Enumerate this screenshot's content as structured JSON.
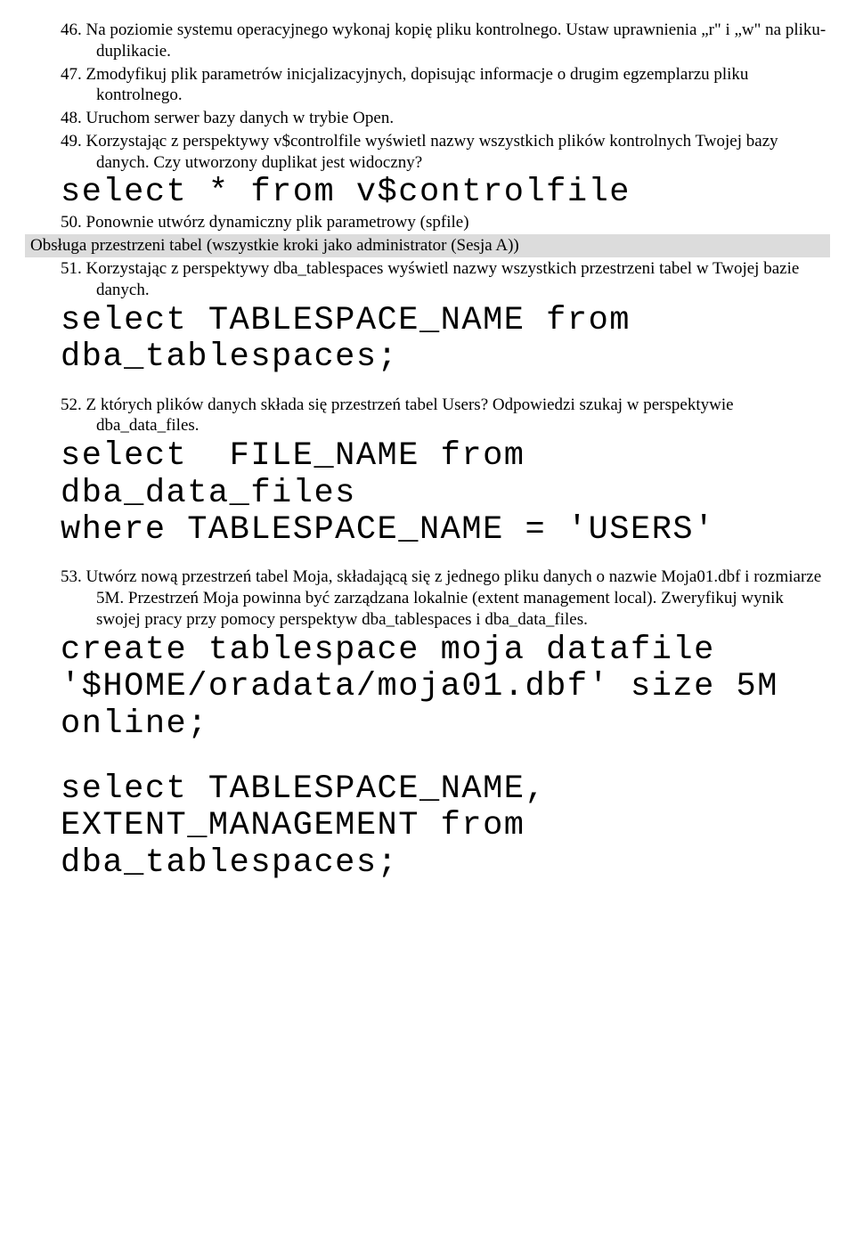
{
  "items": {
    "i46": {
      "num": "46.",
      "text": "Na poziomie systemu operacyjnego wykonaj kopię pliku kontrolnego. Ustaw uprawnienia „r\" i „w\" na pliku-duplikacie."
    },
    "i47": {
      "num": "47.",
      "text": "Zmodyfikuj plik parametrów inicjalizacyjnych, dopisując informacje o drugim egzemplarzu pliku kontrolnego."
    },
    "i48": {
      "num": "48.",
      "text": "Uruchom serwer bazy danych w trybie Open."
    },
    "i49": {
      "num": "49.",
      "text": "Korzystając z perspektywy v$controlfile wyświetl nazwy wszystkich plików kontrolnych Twojej bazy danych. Czy utworzony duplikat jest widoczny?"
    },
    "i50": {
      "num": "50.",
      "text": "Ponownie utwórz dynamiczny plik parametrowy (spfile)"
    },
    "i51": {
      "num": "51.",
      "text": "Korzystając z perspektywy dba_tablespaces wyświetl nazwy wszystkich przestrzeni tabel w Twojej bazie danych."
    },
    "i52": {
      "num": "52.",
      "text": "Z których plików danych składa się przestrzeń tabel Users? Odpowiedzi szukaj w perspektywie dba_data_files."
    },
    "i53": {
      "num": "53.",
      "text": "Utwórz nową przestrzeń tabel Moja, składającą się z jednego pliku danych o nazwie Moja01.dbf i rozmiarze 5M. Przestrzeń Moja powinna być zarządzana lokalnie (extent management local). Zweryfikuj wynik swojej pracy przy pomocy perspektyw dba_tablespaces i dba_data_files."
    }
  },
  "code": {
    "c49": "select * from v$controlfile",
    "c51": "select TABLESPACE_NAME from dba_tablespaces;",
    "c52": "select  FILE_NAME from dba_data_files\nwhere TABLESPACE_NAME = 'USERS'",
    "c53a": "create tablespace moja datafile '$HOME/oradata/moja01.dbf' size 5M online;",
    "c53b": "select TABLESPACE_NAME, EXTENT_MANAGEMENT from dba_tablespaces;"
  },
  "section": {
    "tablespaces": "Obsługa przestrzeni tabel (wszystkie kroki jako administrator (Sesja A))"
  }
}
